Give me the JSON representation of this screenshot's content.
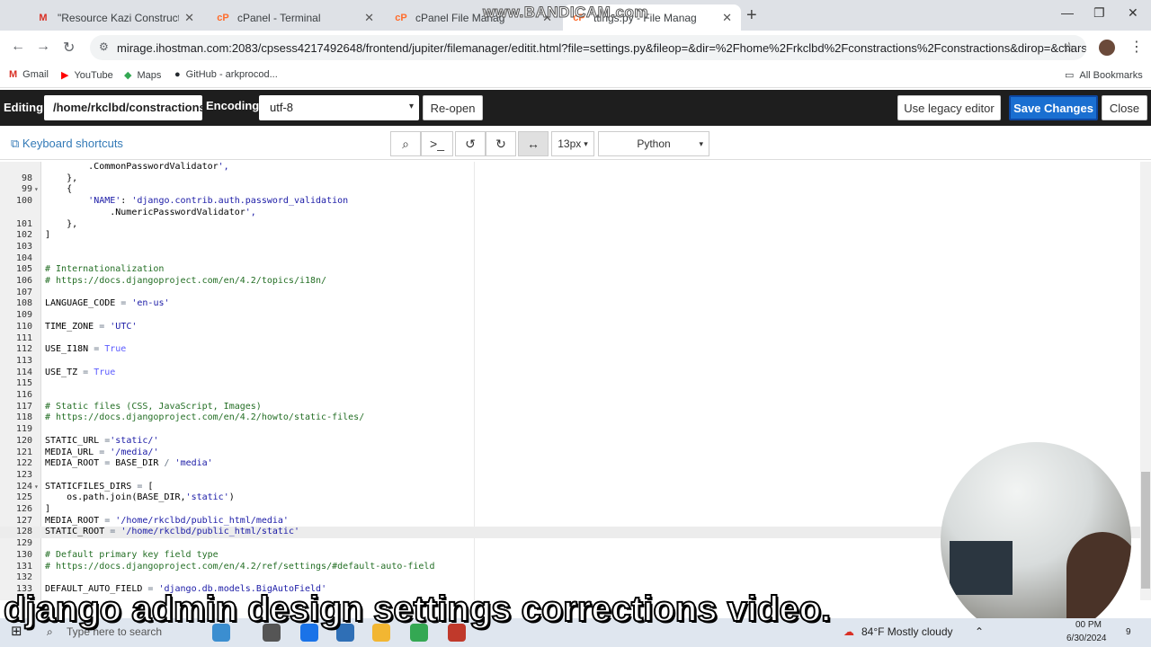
{
  "browser": {
    "tabs": [
      {
        "title": "\"Resource Kazi Construction Ltd",
        "favicon": "M",
        "color": "#d93025"
      },
      {
        "title": "cPanel - Terminal",
        "favicon": "cP",
        "color": "#ff6c2c"
      },
      {
        "title": "cPanel File Manag",
        "favicon": "cP",
        "color": "#ff6c2c"
      },
      {
        "title": "ttings.py - File Manag",
        "favicon": "cP",
        "color": "#ff6c2c"
      }
    ],
    "url": "mirage.ihostman.com:2083/cpsess4217492648/frontend/jupiter/filemanager/editit.html?file=settings.py&fileop=&dir=%2Fhome%2Frkclbd%2Fconstractions%2Fconstractions&dirop=&charset=&file_ch...",
    "bookmarks": [
      {
        "label": "Gmail",
        "icon": "M",
        "color": "#d93025"
      },
      {
        "label": "YouTube",
        "icon": "▶",
        "color": "#ff0000"
      },
      {
        "label": "Maps",
        "icon": "◆",
        "color": "#34a853"
      },
      {
        "label": "GitHub - arkprocod...",
        "icon": "●",
        "color": "#24292e"
      }
    ],
    "all_bookmarks": "All Bookmarks",
    "watermark": "www.BANDICAM.com"
  },
  "editor": {
    "editing_label": "Editing:",
    "path": "/home/rkclbd/constractions/constractions/settings.py",
    "encoding_label": "Encoding:",
    "encoding": "utf-8",
    "reopen": "Re-open",
    "legacy": "Use legacy editor",
    "save": "Save Changes",
    "close": "Close",
    "keyboard_shortcuts": "Keyboard shortcuts",
    "font_size": "13px",
    "language": "Python"
  },
  "code_lines": [
    {
      "n": "",
      "fold": "",
      "text": "        .CommonPasswordValidator',"
    },
    {
      "n": "98",
      "fold": "",
      "text": "    },"
    },
    {
      "n": "99",
      "fold": "▾",
      "text": "    {"
    },
    {
      "n": "100",
      "fold": "",
      "text": "        'NAME': 'django.contrib.auth.password_validation"
    },
    {
      "n": "",
      "fold": "",
      "text": "            .NumericPasswordValidator',"
    },
    {
      "n": "101",
      "fold": "",
      "text": "    },"
    },
    {
      "n": "102",
      "fold": "",
      "text": "]"
    },
    {
      "n": "103",
      "fold": "",
      "text": ""
    },
    {
      "n": "104",
      "fold": "",
      "text": ""
    },
    {
      "n": "105",
      "fold": "",
      "text": "# Internationalization"
    },
    {
      "n": "106",
      "fold": "",
      "text": "# https://docs.djangoproject.com/en/4.2/topics/i18n/"
    },
    {
      "n": "107",
      "fold": "",
      "text": ""
    },
    {
      "n": "108",
      "fold": "",
      "text": "LANGUAGE_CODE = 'en-us'"
    },
    {
      "n": "109",
      "fold": "",
      "text": ""
    },
    {
      "n": "110",
      "fold": "",
      "text": "TIME_ZONE = 'UTC'"
    },
    {
      "n": "111",
      "fold": "",
      "text": ""
    },
    {
      "n": "112",
      "fold": "",
      "text": "USE_I18N = True"
    },
    {
      "n": "113",
      "fold": "",
      "text": ""
    },
    {
      "n": "114",
      "fold": "",
      "text": "USE_TZ = True"
    },
    {
      "n": "115",
      "fold": "",
      "text": ""
    },
    {
      "n": "116",
      "fold": "",
      "text": ""
    },
    {
      "n": "117",
      "fold": "",
      "text": "# Static files (CSS, JavaScript, Images)"
    },
    {
      "n": "118",
      "fold": "",
      "text": "# https://docs.djangoproject.com/en/4.2/howto/static-files/"
    },
    {
      "n": "119",
      "fold": "",
      "text": ""
    },
    {
      "n": "120",
      "fold": "",
      "text": "STATIC_URL ='static/'"
    },
    {
      "n": "121",
      "fold": "",
      "text": "MEDIA_URL = '/media/'"
    },
    {
      "n": "122",
      "fold": "",
      "text": "MEDIA_ROOT = BASE_DIR / 'media'"
    },
    {
      "n": "123",
      "fold": "",
      "text": ""
    },
    {
      "n": "124",
      "fold": "▾",
      "text": "STATICFILES_DIRS = ["
    },
    {
      "n": "125",
      "fold": "",
      "text": "    os.path.join(BASE_DIR,'static')"
    },
    {
      "n": "126",
      "fold": "",
      "text": "]"
    },
    {
      "n": "127",
      "fold": "",
      "text": "MEDIA_ROOT = '/home/rkclbd/public_html/media'"
    },
    {
      "n": "128",
      "fold": "",
      "text": "STATIC_ROOT = '/home/rkclbd/public_html/static'"
    },
    {
      "n": "129",
      "fold": "",
      "text": ""
    },
    {
      "n": "130",
      "fold": "",
      "text": "# Default primary key field type"
    },
    {
      "n": "131",
      "fold": "",
      "text": "# https://docs.djangoproject.com/en/4.2/ref/settings/#default-auto-field"
    },
    {
      "n": "132",
      "fold": "",
      "text": ""
    },
    {
      "n": "133",
      "fold": "",
      "text": "DEFAULT_AUTO_FIELD = 'django.db.models.BigAutoField'"
    }
  ],
  "highlight_line": "128",
  "caption": "django admin design settings corrections video.",
  "taskbar": {
    "search_placeholder": "Type here to search",
    "weather": "84°F  Mostly cloudy",
    "time": "00 PM",
    "date": "6/30/2024",
    "notifications": "9"
  }
}
